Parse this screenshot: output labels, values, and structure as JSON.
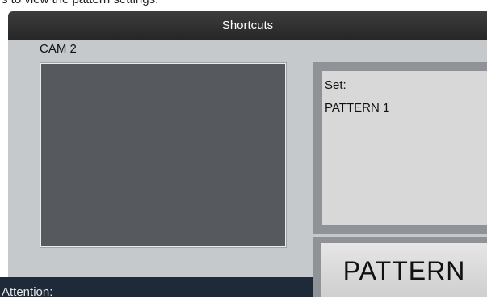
{
  "top_instruction": "s to view the pattern settings.",
  "window": {
    "title": "Shortcuts"
  },
  "camera": {
    "label": "CAM 2"
  },
  "set_panel": {
    "label": "Set:",
    "value": "PATTERN 1"
  },
  "pattern_button": {
    "label": "PATTERN"
  },
  "footer": {
    "attention_label": "Attention:"
  },
  "colors": {
    "titlebar": "#262626",
    "panel_bg": "#c6c9cc",
    "camera_view": "#565a5e",
    "footer_bg": "#1f2a38"
  }
}
